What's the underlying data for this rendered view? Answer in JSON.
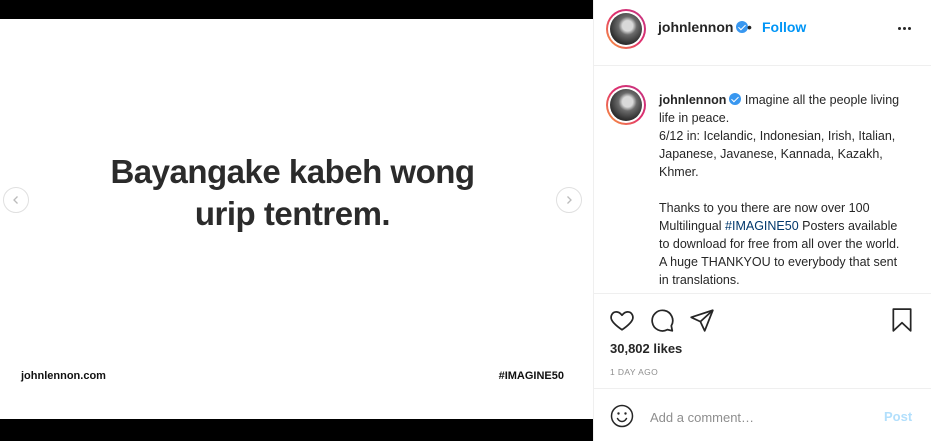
{
  "media": {
    "headline": "Bayangake kabeh wong\nurip tentrem.",
    "footer_left": "johnlennon.com",
    "footer_right": "#IMAGINE50"
  },
  "header": {
    "username": "johnlennon",
    "separator": "•",
    "follow_label": "Follow"
  },
  "caption": {
    "username": "johnlennon",
    "line1": "Imagine all the people living life in peace.",
    "line2": "6/12 in: Icelandic, Indonesian, Irish, Italian, Japanese, Javanese, Kannada, Kazakh, Khmer.",
    "line3_pre": "Thanks to you there are now over 100 Multilingual ",
    "hashtag": "#IMAGINE50",
    "line3_post": " Posters available to download for free from all over the world. A huge THANKYOU to everybody that sent in translations."
  },
  "stats": {
    "likes": "30,802 likes",
    "time": "1 DAY AGO"
  },
  "comment": {
    "placeholder": "Add a comment…",
    "post_label": "Post"
  },
  "colors": {
    "accent": "#0095f6",
    "verified": "#3897f0",
    "hashtag": "#00376b",
    "post_disabled": "#b2dffc"
  },
  "icons": [
    "chevron-left-icon",
    "chevron-right-icon",
    "verified-badge-icon",
    "more-options-icon",
    "heart-icon",
    "comment-icon",
    "share-icon",
    "bookmark-icon",
    "emoji-icon"
  ]
}
